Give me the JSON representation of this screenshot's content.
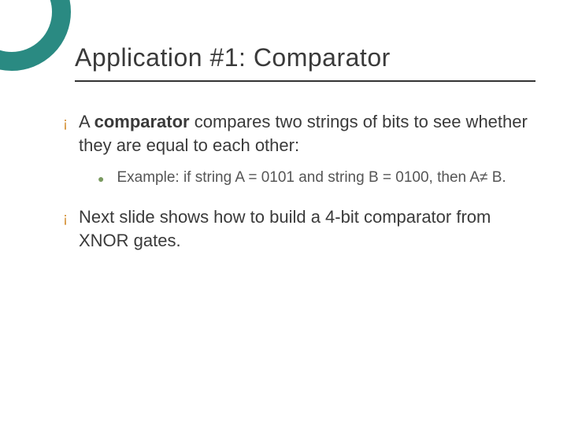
{
  "title": "Application #1: Comparator",
  "bullets": {
    "b1": {
      "pre": "A ",
      "bold": "comparator",
      "post": " compares two strings of bits to see whether they are equal to each other:",
      "sub": "Example: if string A = 0101 and string B = 0100, then A≠ B."
    },
    "b2": "Next slide shows how to build a 4-bit comparator from XNOR gates."
  },
  "glyphs": {
    "hollow_circle": "¡",
    "solid_dot": "●"
  }
}
